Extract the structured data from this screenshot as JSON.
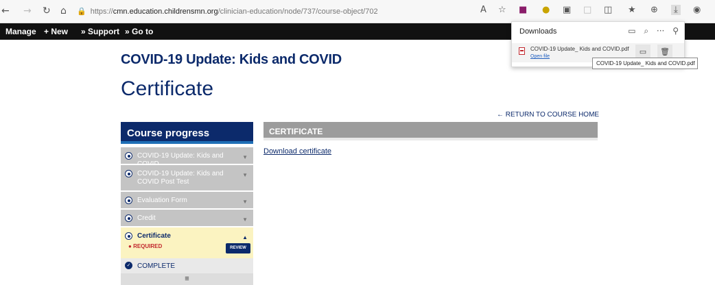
{
  "browser": {
    "url_prefix": "https://",
    "url_host": "cmn.education.childrensmn.org",
    "url_path": "/clinician-education/node/737/course-object/702",
    "icons": [
      "back-icon",
      "forward-icon",
      "refresh-icon",
      "home-icon",
      "lock-icon",
      "read-aloud-icon",
      "favorite-icon",
      "extension-icon",
      "favorites-bar-icon",
      "collections-icon",
      "downloads-icon",
      "profile-icon"
    ]
  },
  "admin_toolbar": {
    "manage": "Manage",
    "new": "+ New",
    "support": "» Support",
    "goto": "» Go to"
  },
  "page": {
    "course_title": "COVID-19 Update: Kids and COVID",
    "title": "Certificate",
    "return_link": "← RETURN TO COURSE HOME"
  },
  "course_progress": {
    "header": "Course progress",
    "items": [
      {
        "label": "COVID-19 Update: Kids and COVID"
      },
      {
        "label": "COVID-19 Update: Kids and COVID Post Test"
      },
      {
        "label": "Evaluation Form"
      },
      {
        "label": "Credit"
      },
      {
        "label": "Certificate"
      }
    ],
    "required": "REQUIRED",
    "review": "REVIEW",
    "complete": "COMPLETE",
    "menu_icon": "≡"
  },
  "certificate_panel": {
    "header": "CERTIFICATE",
    "download_link": "Download certificate"
  },
  "downloads": {
    "title": "Downloads",
    "file_name": "COVID-19 Update_ Kids and COVID.pdf",
    "open_file": "Open file",
    "tooltip": "COVID-19 Update_ Kids and COVID.pdf"
  },
  "colors": {
    "brand_navy": "#0c2a6b",
    "accent_blue": "#1f6fb6",
    "active_yellow": "#fbf3c1",
    "required_red": "#c1272d"
  }
}
